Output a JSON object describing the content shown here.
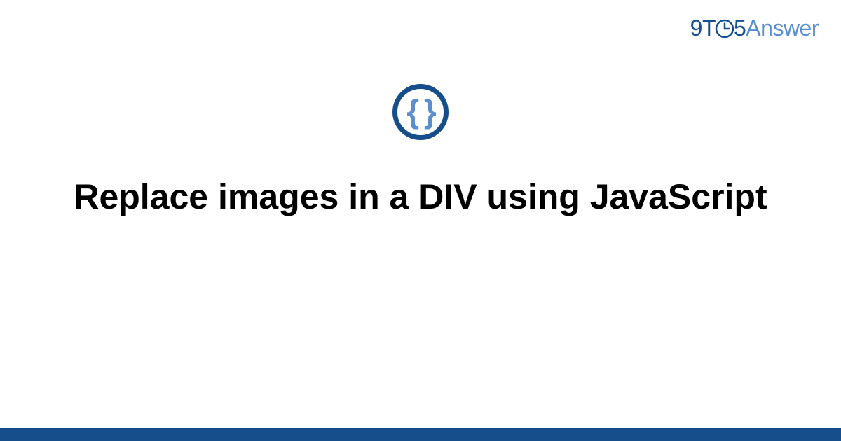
{
  "logo": {
    "part1": "9T",
    "part2": "5",
    "part3": "Answer"
  },
  "icon": {
    "name": "braces-icon",
    "glyph": "{ }"
  },
  "title": "Replace images in a DIV using JavaScript",
  "colors": {
    "dark_blue": "#164e8c",
    "light_blue": "#5a8fcf"
  }
}
